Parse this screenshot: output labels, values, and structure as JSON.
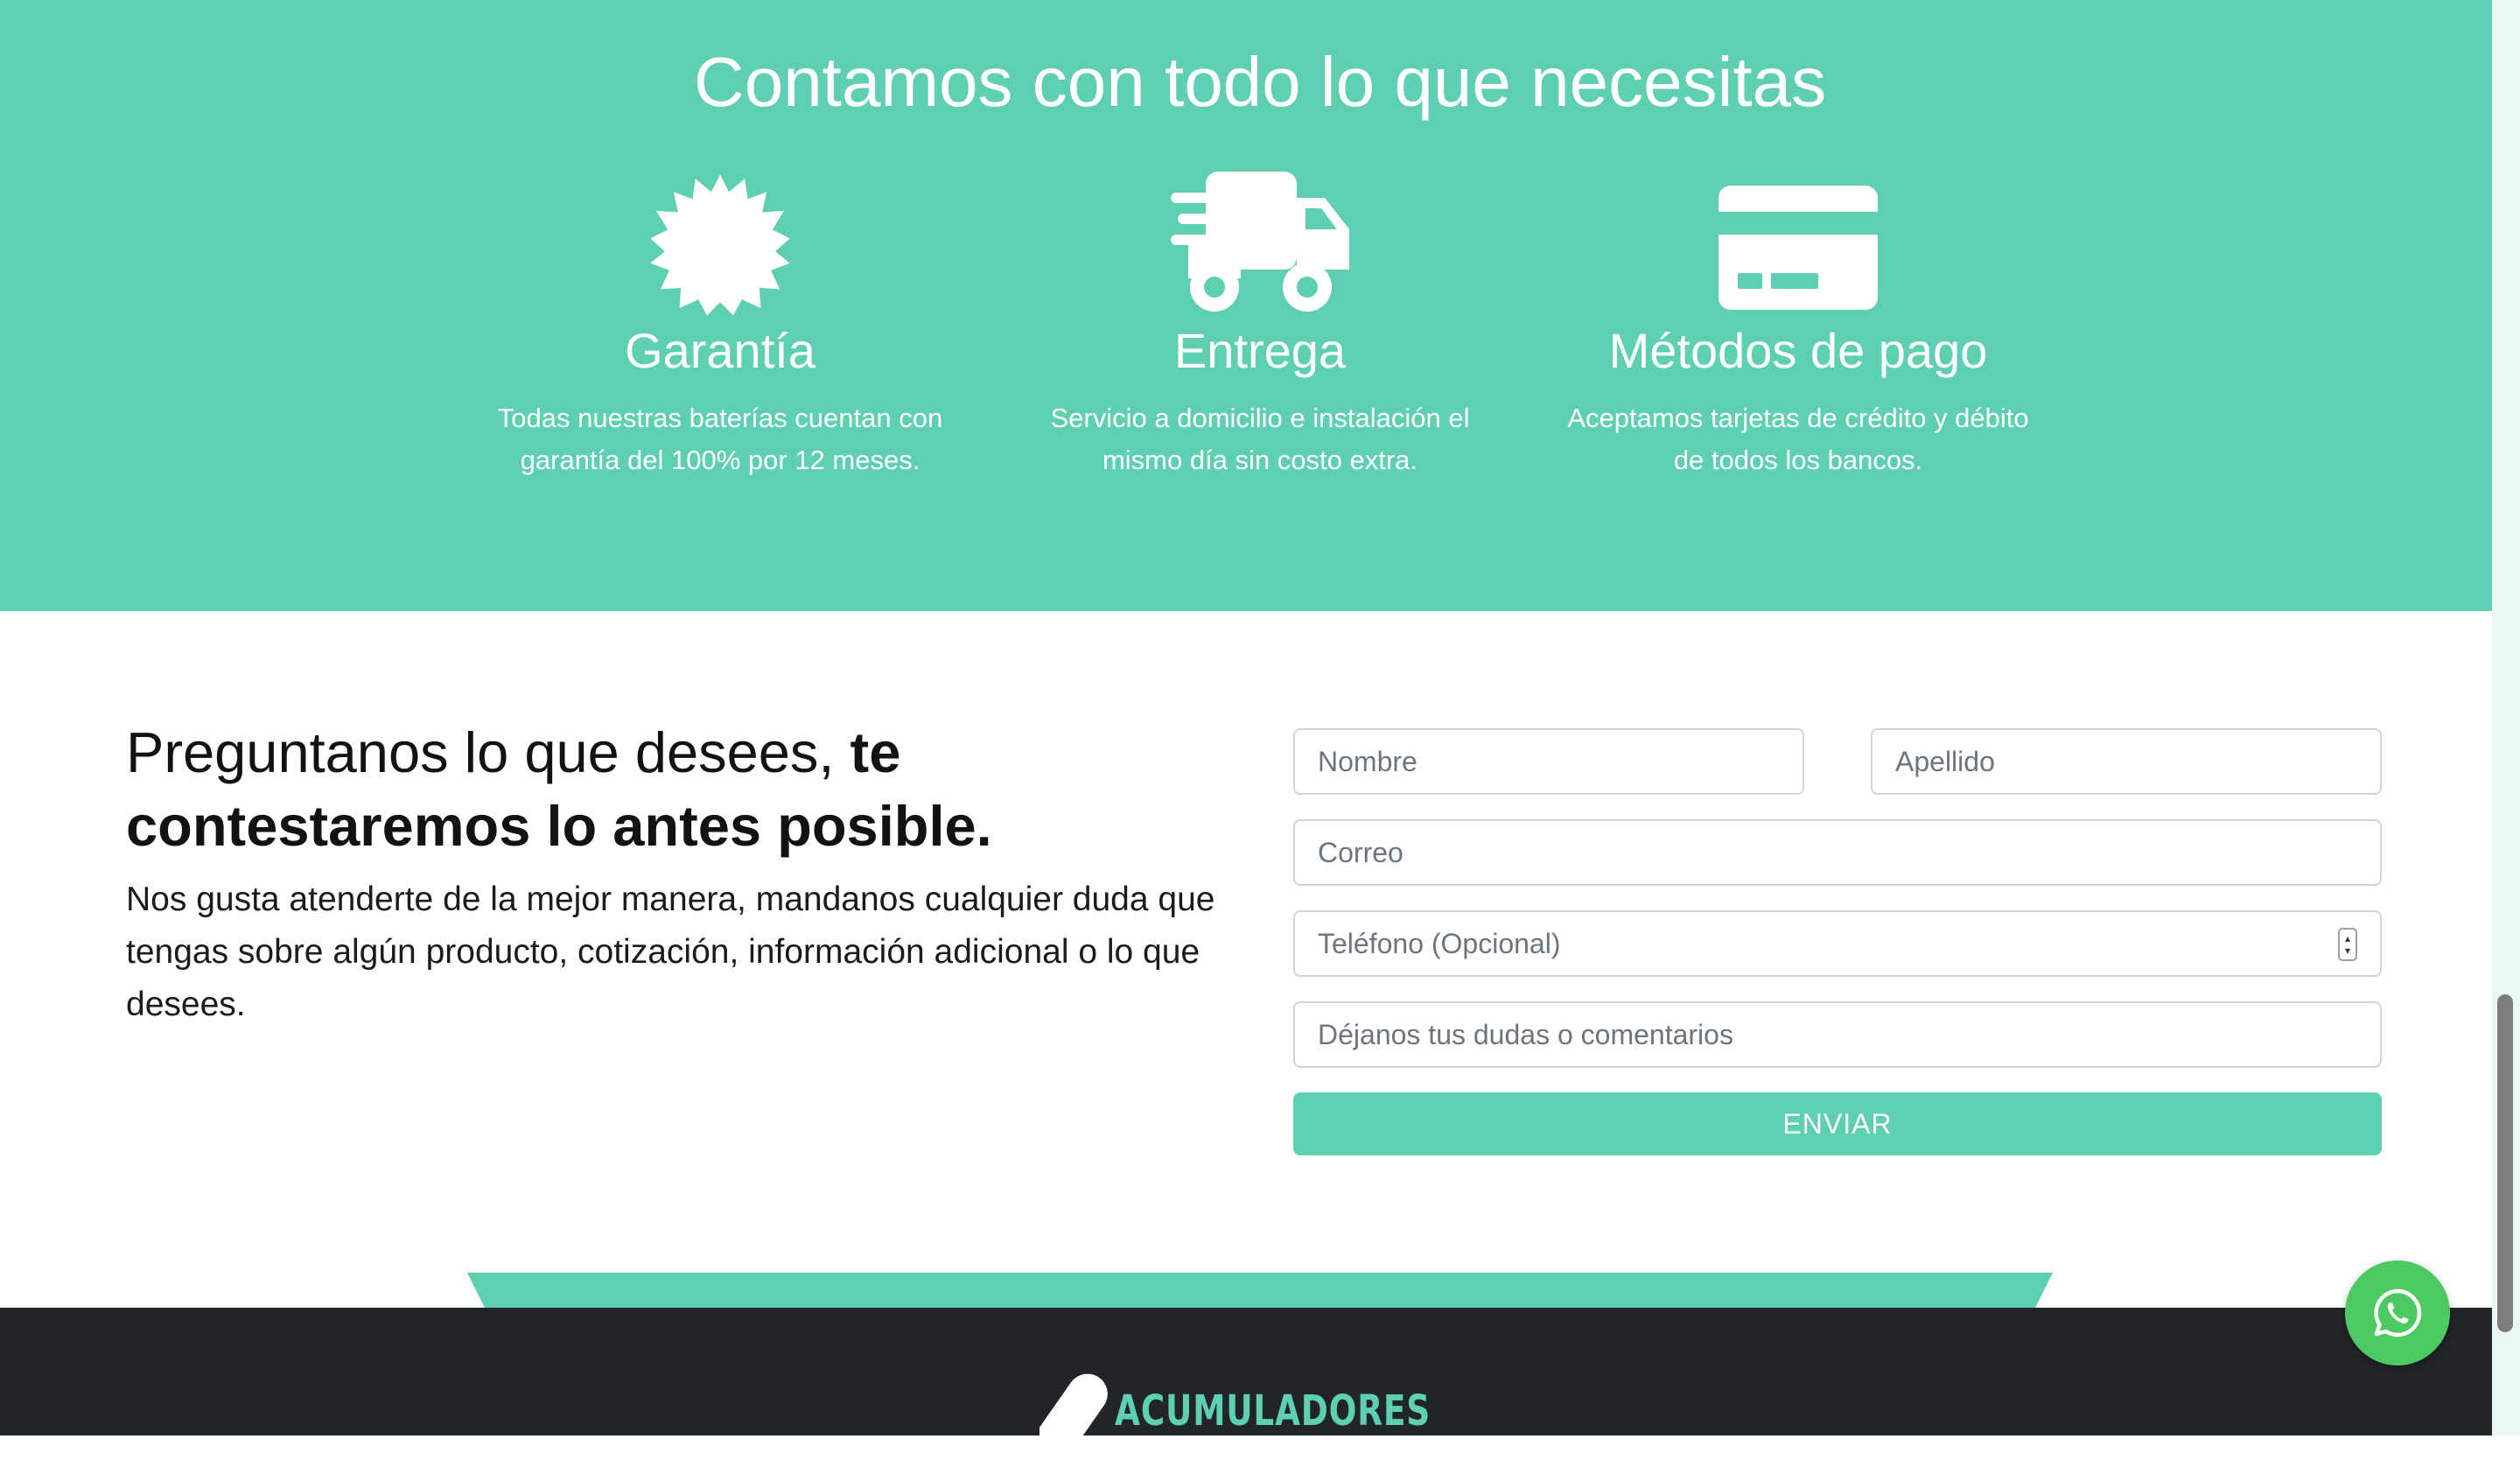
{
  "features": {
    "title": "Contamos con todo lo que necesitas",
    "items": [
      {
        "icon": "badge-icon",
        "title": "Garantía",
        "line1": "Todas nuestras baterías cuentan con",
        "line2": "garantía del 100% por 12 meses."
      },
      {
        "icon": "truck-icon",
        "title": "Entrega",
        "line1": "Servicio a domicilio e instalación el",
        "line2": "mismo día sin costo extra."
      },
      {
        "icon": "credit-card-icon",
        "title": "Métodos de pago",
        "line1": "Aceptamos tarjetas de crédito y débito",
        "line2": "de todos los bancos."
      }
    ]
  },
  "contact": {
    "heading_normal": "Preguntanos lo que desees, ",
    "heading_bold_1": "te",
    "heading_bold_2": "contestaremos lo antes posible.",
    "text": "Nos gusta atenderte de la mejor manera, mandanos cualquier duda que tengas sobre algún producto, cotización, información adicional o lo que desees.",
    "form": {
      "first_name_placeholder": "Nombre",
      "last_name_placeholder": "Apellido",
      "email_placeholder": "Correo",
      "phone_placeholder": "Teléfono (Opcional)",
      "comments_placeholder": "Déjanos tus dudas o comentarios",
      "submit_label": "ENVIAR"
    }
  },
  "footer": {
    "logo_text": "ACUMULADORES"
  },
  "colors": {
    "accent": "#5fcfb2",
    "footer_bg": "#212529",
    "whatsapp": "#4dc962"
  }
}
